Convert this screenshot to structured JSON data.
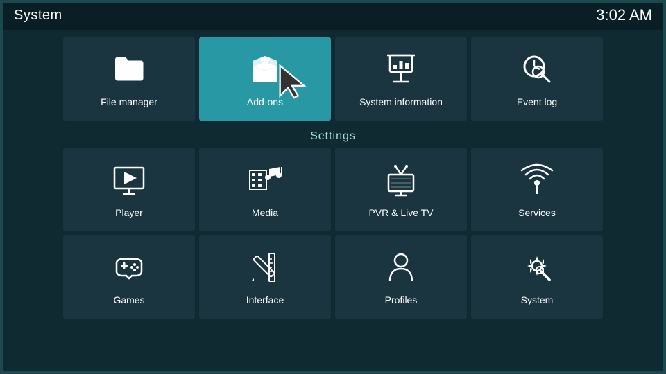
{
  "header": {
    "title": "System",
    "time": "3:02 AM"
  },
  "top_tiles": [
    {
      "id": "file-manager",
      "label": "File manager",
      "icon": "folder"
    },
    {
      "id": "add-ons",
      "label": "Add-ons",
      "icon": "box",
      "active": true
    },
    {
      "id": "system-information",
      "label": "System information",
      "icon": "chart"
    },
    {
      "id": "event-log",
      "label": "Event log",
      "icon": "clock-search"
    }
  ],
  "settings_label": "Settings",
  "settings_row1": [
    {
      "id": "player",
      "label": "Player",
      "icon": "play-monitor"
    },
    {
      "id": "media",
      "label": "Media",
      "icon": "film-music"
    },
    {
      "id": "pvr-live-tv",
      "label": "PVR & Live TV",
      "icon": "tv-antenna"
    },
    {
      "id": "services",
      "label": "Services",
      "icon": "wifi-broadcast"
    }
  ],
  "settings_row2": [
    {
      "id": "games",
      "label": "Games",
      "icon": "gamepad"
    },
    {
      "id": "interface",
      "label": "Interface",
      "icon": "pencil-ruler"
    },
    {
      "id": "profiles",
      "label": "Profiles",
      "icon": "person"
    },
    {
      "id": "system",
      "label": "System",
      "icon": "gear-wrench"
    }
  ]
}
